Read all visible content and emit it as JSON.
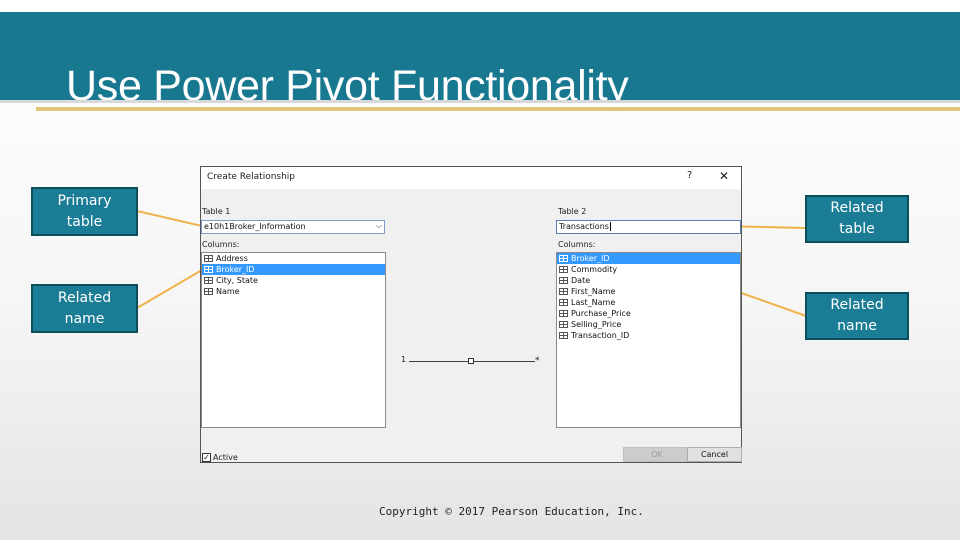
{
  "slide": {
    "title": "Use Power Pivot Functionality",
    "footer": "Copyright © 2017 Pearson Education, Inc."
  },
  "callouts": {
    "primary_table": [
      "Primary",
      "table"
    ],
    "related_name_left": [
      "Related",
      "name"
    ],
    "related_table": [
      "Related",
      "table"
    ],
    "related_name_right": [
      "Related",
      "name"
    ]
  },
  "dialog": {
    "title": "Create Relationship",
    "help": "?",
    "close": "✕",
    "table1_label": "Table 1",
    "table1_value": "e10h1Broker_Information",
    "columns_label": "Columns:",
    "table1_columns": [
      "Address",
      "Broker_ID",
      "City, State",
      "Name"
    ],
    "table1_selected": "Broker_ID",
    "table2_label": "Table 2",
    "table2_value": "Transactions",
    "table2_columns": [
      "Broker_ID",
      "Commodity",
      "Date",
      "First_Name",
      "Last_Name",
      "Purchase_Price",
      "Selling_Price",
      "Transaction_ID"
    ],
    "table2_selected": "Broker_ID",
    "cardinality_one": "1",
    "cardinality_many": "*",
    "active_label": "Active",
    "active_checked": "✓",
    "ok_label": "OK",
    "cancel_label": "Cancel"
  },
  "colors": {
    "header": "#17788f",
    "callout": "#1b7d95",
    "leader": "#f0b24a",
    "selection": "#3399ff"
  }
}
